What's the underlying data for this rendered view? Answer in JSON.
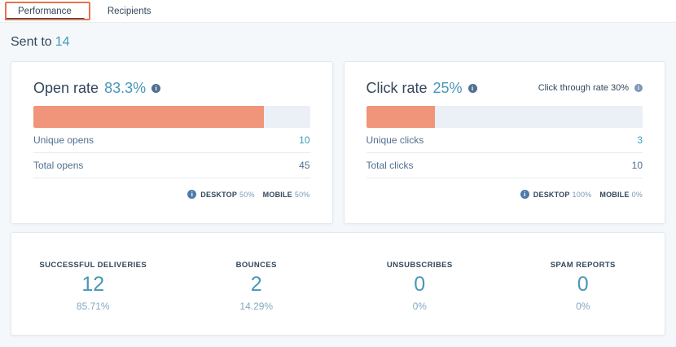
{
  "tabs": [
    {
      "label": "Performance",
      "active": true
    },
    {
      "label": "Recipients",
      "active": false
    }
  ],
  "sent_to": {
    "label": "Sent to",
    "value": "14"
  },
  "open_rate_card": {
    "title": "Open rate",
    "rate": "83.3%",
    "bar_percent": 83.3,
    "rows": [
      {
        "label": "Unique opens",
        "value": "10"
      },
      {
        "label": "Total opens",
        "value": "45"
      }
    ],
    "devices": {
      "desktop_label": "DESKTOP",
      "desktop_value": "50%",
      "mobile_label": "MOBILE",
      "mobile_value": "50%"
    }
  },
  "click_rate_card": {
    "title": "Click rate",
    "rate": "25%",
    "bar_percent": 25,
    "click_through_label": "Click through rate 30%",
    "rows": [
      {
        "label": "Unique clicks",
        "value": "3"
      },
      {
        "label": "Total clicks",
        "value": "10"
      }
    ],
    "devices": {
      "desktop_label": "DESKTOP",
      "desktop_value": "100%",
      "mobile_label": "MOBILE",
      "mobile_value": "0%"
    }
  },
  "summary": {
    "stats": [
      {
        "label": "SUCCESSFUL DELIVERIES",
        "value": "12",
        "percent": "85.71%"
      },
      {
        "label": "BOUNCES",
        "value": "2",
        "percent": "14.29%"
      },
      {
        "label": "UNSUBSCRIBES",
        "value": "0",
        "percent": "0%"
      },
      {
        "label": "SPAM REPORTS",
        "value": "0",
        "percent": "0%"
      }
    ]
  },
  "icons": {
    "info": "i"
  },
  "colors": {
    "accent_bar_fill": "#f0947a",
    "bar_track": "#eaf0f6",
    "highlight_box": "#e8734c",
    "teal_link": "#4a96b8",
    "dark_slate": "#33475b",
    "muted_slate": "#516f90",
    "page_background": "#f5f8fa"
  }
}
